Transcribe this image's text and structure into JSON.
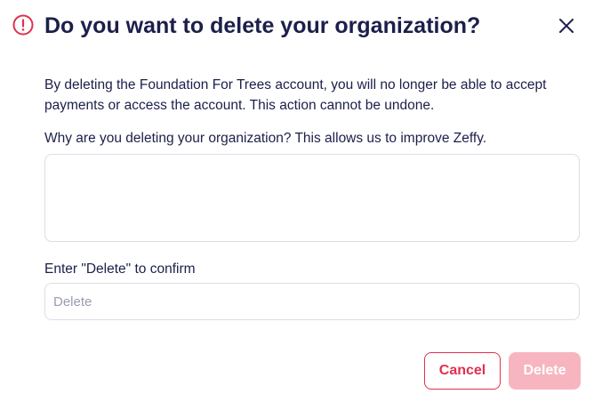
{
  "dialog": {
    "title": "Do you want to delete your organization?",
    "description": "By deleting the Foundation For Trees account, you will no longer be able to accept payments or access the account. This action cannot be undone.",
    "reason_label": "Why are you deleting your organization? This allows us to improve Zeffy.",
    "reason_value": "",
    "confirm_label": "Enter \"Delete\" to confirm",
    "confirm_placeholder": "Delete",
    "confirm_value": "",
    "cancel_label": "Cancel",
    "delete_label": "Delete",
    "icons": {
      "header": "warning-circle-icon",
      "close": "close-icon"
    },
    "colors": {
      "text": "#1c1f4a",
      "danger": "#e1304e",
      "danger_disabled": "#f7b5bf",
      "border": "#dcdde6",
      "placeholder": "#9a9cb1"
    }
  }
}
